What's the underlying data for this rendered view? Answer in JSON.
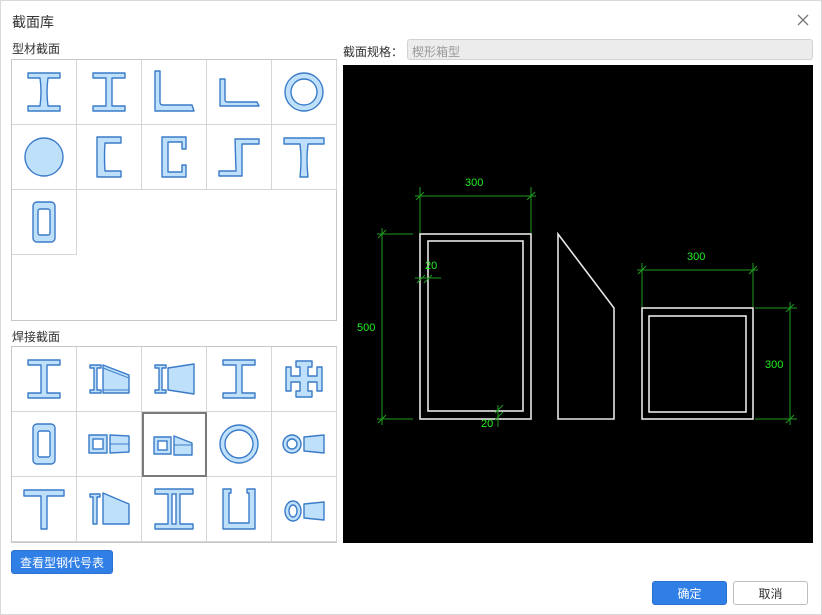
{
  "dialog": {
    "title": "截面库"
  },
  "profile_section": {
    "label": "型材截面",
    "items": [
      "i-beam",
      "h-beam",
      "angle-steel",
      "unequal-angle",
      "round-tube",
      "solid-round",
      "channel",
      "lipped-channel",
      "z-section",
      "t-section",
      "rect-tube"
    ]
  },
  "welded_section": {
    "label": "焊接截面",
    "items": [
      "welded-i-beam",
      "tapered-i-beam",
      "tapered-i-beam-flared",
      "welded-h-beam",
      "cross-section",
      "welded-rect-tube",
      "tapered-box",
      "tapered-box-wedge",
      "welded-round-tube",
      "tapered-round-tube",
      "welded-t-section",
      "tapered-t-section",
      "double-channel",
      "u-section",
      "tapered-oval-tube"
    ],
    "selected": "tapered-box-wedge"
  },
  "spec": {
    "label": "截面规格：",
    "value": "楔形箱型"
  },
  "preview": {
    "left_box": {
      "width_label": "300",
      "height_label": "500",
      "thickness_top": "20",
      "thickness_bottom": "20"
    },
    "right_box": {
      "width_label": "300",
      "height_label": "300"
    }
  },
  "buttons": {
    "view_table": "查看型钢代号表",
    "ok": "确定",
    "cancel": "取消"
  },
  "colors": {
    "accent": "#2f7fe6",
    "shape_fill": "#bfe0fb",
    "shape_stroke": "#3a7bc8",
    "dimension": "#22ee22"
  }
}
